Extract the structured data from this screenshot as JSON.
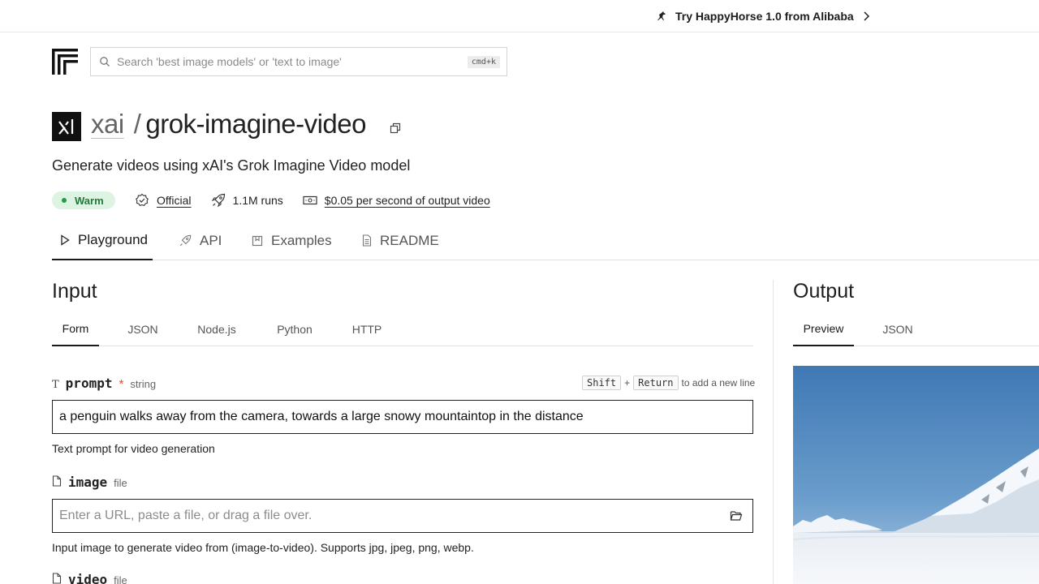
{
  "announcement": {
    "text": "Try HappyHorse 1.0 from Alibaba"
  },
  "search": {
    "placeholder": "Search 'best image models' or 'text to image'",
    "shortcut": "cmd+k"
  },
  "model": {
    "owner": "xai",
    "name": "grok-imagine-video",
    "description": "Generate videos using xAI's Grok Imagine Video model",
    "status": "Warm",
    "official_label": "Official",
    "runs": "1.1M runs",
    "pricing": "$0.05 per second of output video"
  },
  "main_tabs": [
    {
      "label": "Playground",
      "icon": "play-icon",
      "active": true
    },
    {
      "label": "API",
      "icon": "rocket-icon",
      "active": false
    },
    {
      "label": "Examples",
      "icon": "bookmark-icon",
      "active": false
    },
    {
      "label": "README",
      "icon": "document-icon",
      "active": false
    }
  ],
  "input": {
    "heading": "Input",
    "tabs": [
      "Form",
      "JSON",
      "Node.js",
      "Python",
      "HTTP"
    ],
    "active_tab": "Form",
    "newline_hint": {
      "key1": "Shift",
      "plus": "+",
      "key2": "Return",
      "text": "to add a new line"
    },
    "fields": {
      "prompt": {
        "name": "prompt",
        "required_mark": "*",
        "type": "string",
        "value": "a penguin walks away from the camera, towards a large snowy mountaintop in the distance",
        "help": "Text prompt for video generation"
      },
      "image": {
        "name": "image",
        "type": "file",
        "placeholder": "Enter a URL, paste a file, or drag a file over.",
        "help": "Input image to generate video from (image-to-video). Supports jpg, jpeg, png, webp."
      },
      "video": {
        "name": "video",
        "type": "file"
      }
    }
  },
  "output": {
    "heading": "Output",
    "tabs": [
      "Preview",
      "JSON"
    ],
    "active_tab": "Preview"
  },
  "colors": {
    "warm_badge_bg": "#def4e2",
    "warm_badge_text": "#1f7a3a",
    "required": "#d94b3a",
    "sky": "#4f86bd"
  }
}
